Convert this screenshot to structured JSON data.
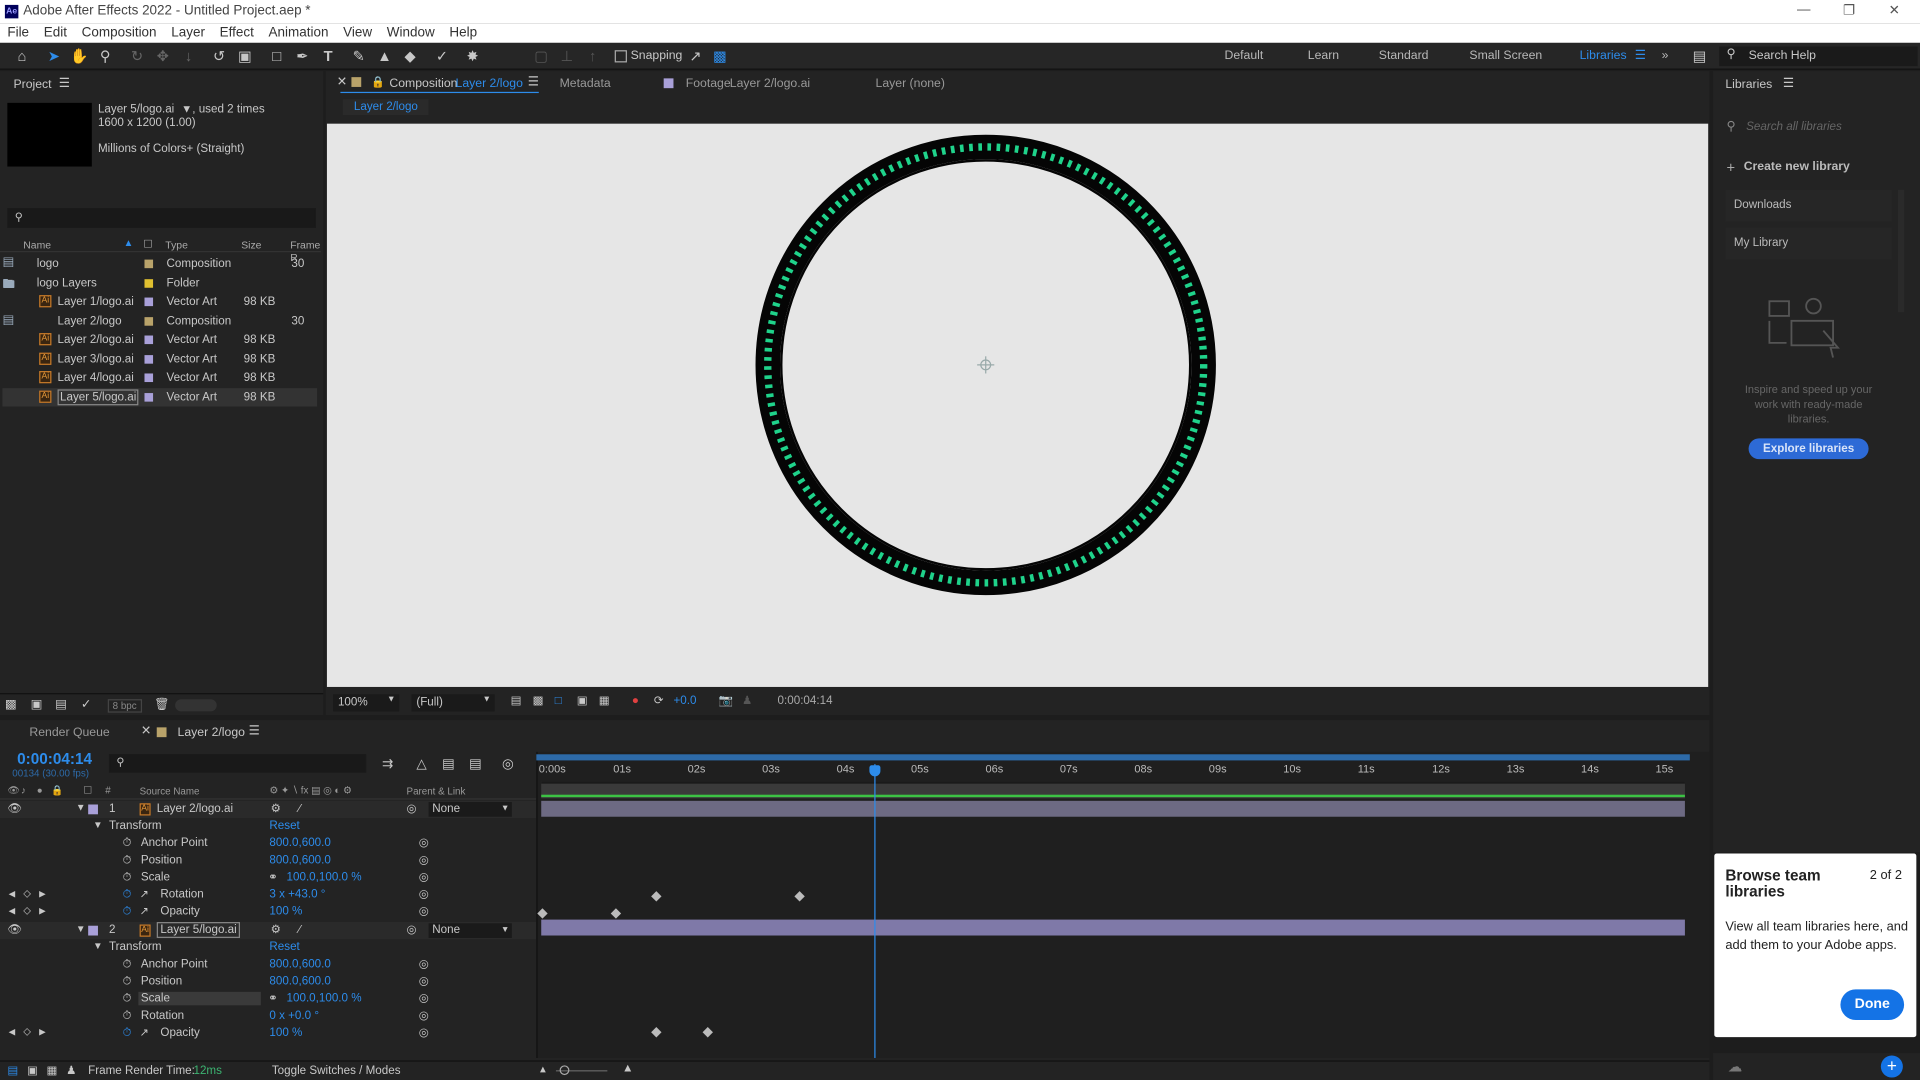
{
  "app": {
    "title": "Adobe After Effects 2022 - Untitled Project.aep *",
    "logo": "Ae"
  },
  "menu": [
    "File",
    "Edit",
    "Composition",
    "Layer",
    "Effect",
    "Animation",
    "View",
    "Window",
    "Help"
  ],
  "toolbar": {
    "snapping": "Snapping",
    "search_placeholder": "Search Help",
    "workspaces": [
      "Default",
      "Learn",
      "Standard",
      "Small Screen",
      "Libraries"
    ],
    "active_workspace": "Libraries"
  },
  "project": {
    "title": "Project",
    "selected_name": "Layer 5/logo.ai",
    "used": ", used 2 times",
    "dims": "1600 x 1200 (1.00)",
    "colors": "Millions of Colors+ (Straight)",
    "columns": [
      "Name",
      "Type",
      "Size",
      "Frame R"
    ],
    "items": [
      {
        "name": "logo",
        "type": "Composition",
        "size": "",
        "frame": "30",
        "color": "#b9a36a",
        "icon": "comp"
      },
      {
        "name": "logo Layers",
        "type": "Folder",
        "size": "",
        "frame": "",
        "color": "#e0c030",
        "icon": "folder"
      },
      {
        "name": "Layer 1/logo.ai",
        "type": "Vector Art",
        "size": "98 KB",
        "frame": "",
        "color": "#a9a0d9",
        "icon": "ai"
      },
      {
        "name": "Layer 2/logo",
        "type": "Composition",
        "size": "",
        "frame": "30",
        "color": "#b9a36a",
        "icon": "comp"
      },
      {
        "name": "Layer 2/logo.ai",
        "type": "Vector Art",
        "size": "98 KB",
        "frame": "",
        "color": "#a9a0d9",
        "icon": "ai"
      },
      {
        "name": "Layer 3/logo.ai",
        "type": "Vector Art",
        "size": "98 KB",
        "frame": "",
        "color": "#a9a0d9",
        "icon": "ai"
      },
      {
        "name": "Layer 4/logo.ai",
        "type": "Vector Art",
        "size": "98 KB",
        "frame": "",
        "color": "#a9a0d9",
        "icon": "ai"
      },
      {
        "name": "Layer 5/logo.ai",
        "type": "Vector Art",
        "size": "98 KB",
        "frame": "",
        "color": "#a9a0d9",
        "icon": "ai"
      }
    ],
    "bpc": "8 bpc"
  },
  "viewer": {
    "tabs": {
      "comp_prefix": "Composition",
      "comp_name": "Layer 2/logo",
      "metadata": "Metadata",
      "footage_prefix": "Footage",
      "footage_name": "Layer 2/logo.ai",
      "layer": "Layer  (none)"
    },
    "breadcrumb": "Layer 2/logo",
    "zoom": "100%",
    "resolution": "(Full)",
    "exposure": "+0.0",
    "timecode": "0:00:04:14",
    "ring_color": "#1fd38b"
  },
  "libraries": {
    "title": "Libraries",
    "search_placeholder": "Search all libraries",
    "create": "Create new library",
    "items": [
      "Downloads",
      "My Library"
    ],
    "promo": "Inspire and speed up your work with ready-made libraries.",
    "explore": "Explore libraries"
  },
  "tooltip": {
    "title": "Browse team libraries",
    "counter": "2 of 2",
    "body": "View all team libraries here, and add them to your Adobe apps.",
    "done": "Done"
  },
  "timeline": {
    "render_queue": "Render Queue",
    "comp_tab": "Layer 2/logo",
    "timecode": "0:00:04:14",
    "frame_info": "00134 (30.00 fps)",
    "col_source": "Source Name",
    "col_parent": "Parent & Link",
    "ruler": [
      "0:00s",
      "01s",
      "02s",
      "03s",
      "04s",
      "05s",
      "06s",
      "07s",
      "08s",
      "09s",
      "10s",
      "11s",
      "12s",
      "13s",
      "14s",
      "15s"
    ],
    "layers": [
      {
        "num": "1",
        "name": "Layer 2/logo.ai",
        "parent": "None",
        "props": [
          {
            "name": "Transform",
            "value": "Reset"
          },
          {
            "name": "Anchor Point",
            "value": "800.0,600.0"
          },
          {
            "name": "Position",
            "value": "800.0,600.0"
          },
          {
            "name": "Scale",
            "value": "100.0,100.0 %"
          },
          {
            "name": "Rotation",
            "value": "3 x +43.0 °"
          },
          {
            "name": "Opacity",
            "value": "100 %"
          }
        ]
      },
      {
        "num": "2",
        "name": "Layer 5/logo.ai",
        "parent": "None",
        "props": [
          {
            "name": "Transform",
            "value": "Reset"
          },
          {
            "name": "Anchor Point",
            "value": "800.0,600.0"
          },
          {
            "name": "Position",
            "value": "800.0,600.0"
          },
          {
            "name": "Scale",
            "value": "100.0,100.0 %"
          },
          {
            "name": "Rotation",
            "value": "0 x +0.0 °"
          },
          {
            "name": "Opacity",
            "value": "100 %"
          }
        ]
      }
    ],
    "status_render": "Frame Render Time:",
    "render_time": "12ms",
    "toggle": "Toggle Switches / Modes"
  }
}
